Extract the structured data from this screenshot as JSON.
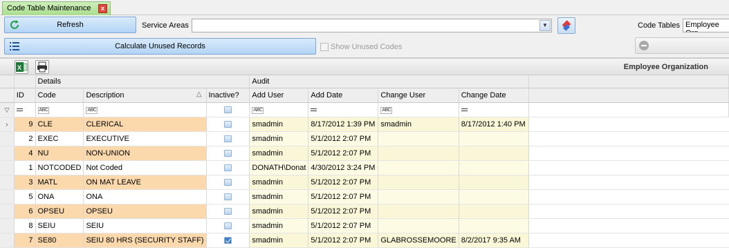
{
  "tab": {
    "title": "Code Table Maintenance",
    "close": "x"
  },
  "toolbar": {
    "refresh_label": "Refresh",
    "service_areas_label": "Service Areas",
    "service_areas_value": "",
    "code_tables_label": "Code Tables",
    "code_tables_value": "Employee Org",
    "calculate_label": "Calculate Unused Records",
    "show_unused_label": "Show Unused Codes"
  },
  "grid": {
    "title": "Employee Organization",
    "bands": {
      "details": "Details",
      "audit": "Audit"
    },
    "columns": [
      "ID",
      "Code",
      "Description",
      "Inactive?",
      "Add User",
      "Add Date",
      "Change User",
      "Change Date"
    ],
    "rows": [
      {
        "id": "9",
        "code": "CLE",
        "desc": "CLERICAL",
        "inactive": false,
        "add_user": "smadmin",
        "add_date": "8/17/2012 1:39 PM",
        "change_user": "smadmin",
        "change_date": "8/17/2012 1:40 PM",
        "current": true
      },
      {
        "id": "2",
        "code": "EXEC",
        "desc": "EXECUTIVE",
        "inactive": false,
        "add_user": "smadmin",
        "add_date": "5/1/2012 2:07 PM",
        "change_user": "",
        "change_date": ""
      },
      {
        "id": "4",
        "code": "NU",
        "desc": "NON-UNION",
        "inactive": false,
        "add_user": "smadmin",
        "add_date": "5/1/2012 2:07 PM",
        "change_user": "",
        "change_date": ""
      },
      {
        "id": "1",
        "code": "NOTCODED",
        "desc": "Not Coded",
        "inactive": false,
        "add_user": "DONATH\\Donat",
        "add_date": "4/30/2012 3:24 PM",
        "change_user": "",
        "change_date": ""
      },
      {
        "id": "3",
        "code": "MATL",
        "desc": "ON MAT LEAVE",
        "inactive": false,
        "add_user": "smadmin",
        "add_date": "5/1/2012 2:07 PM",
        "change_user": "",
        "change_date": ""
      },
      {
        "id": "5",
        "code": "ONA",
        "desc": "ONA",
        "inactive": false,
        "add_user": "smadmin",
        "add_date": "5/1/2012 2:07 PM",
        "change_user": "",
        "change_date": ""
      },
      {
        "id": "6",
        "code": "OPSEU",
        "desc": "OPSEU",
        "inactive": false,
        "add_user": "smadmin",
        "add_date": "5/1/2012 2:07 PM",
        "change_user": "",
        "change_date": ""
      },
      {
        "id": "8",
        "code": "SEIU",
        "desc": "SEIU",
        "inactive": false,
        "add_user": "smadmin",
        "add_date": "5/1/2012 2:07 PM",
        "change_user": "",
        "change_date": ""
      },
      {
        "id": "7",
        "code": "SE80",
        "desc": "SEIU 80 HRS (SECURITY STAFF)",
        "inactive": true,
        "add_user": "smadmin",
        "add_date": "5/1/2012 2:07 PM",
        "change_user": "GLABROSSEMOORE",
        "change_date": "8/2/2017 9:35 AM"
      }
    ]
  },
  "icons": {
    "refresh": "refresh-icon",
    "eraser": "eraser-icon",
    "list": "list-icon",
    "excel": "excel-export-icon",
    "print": "print-icon",
    "filter": "filter-icon",
    "row_pointer": "row-pointer-icon"
  },
  "colors": {
    "tab": "#a9dd8e",
    "row_highlight": "#fbd9ad",
    "audit_bg": "#fdfbe4",
    "button": "#b3d4f5"
  }
}
